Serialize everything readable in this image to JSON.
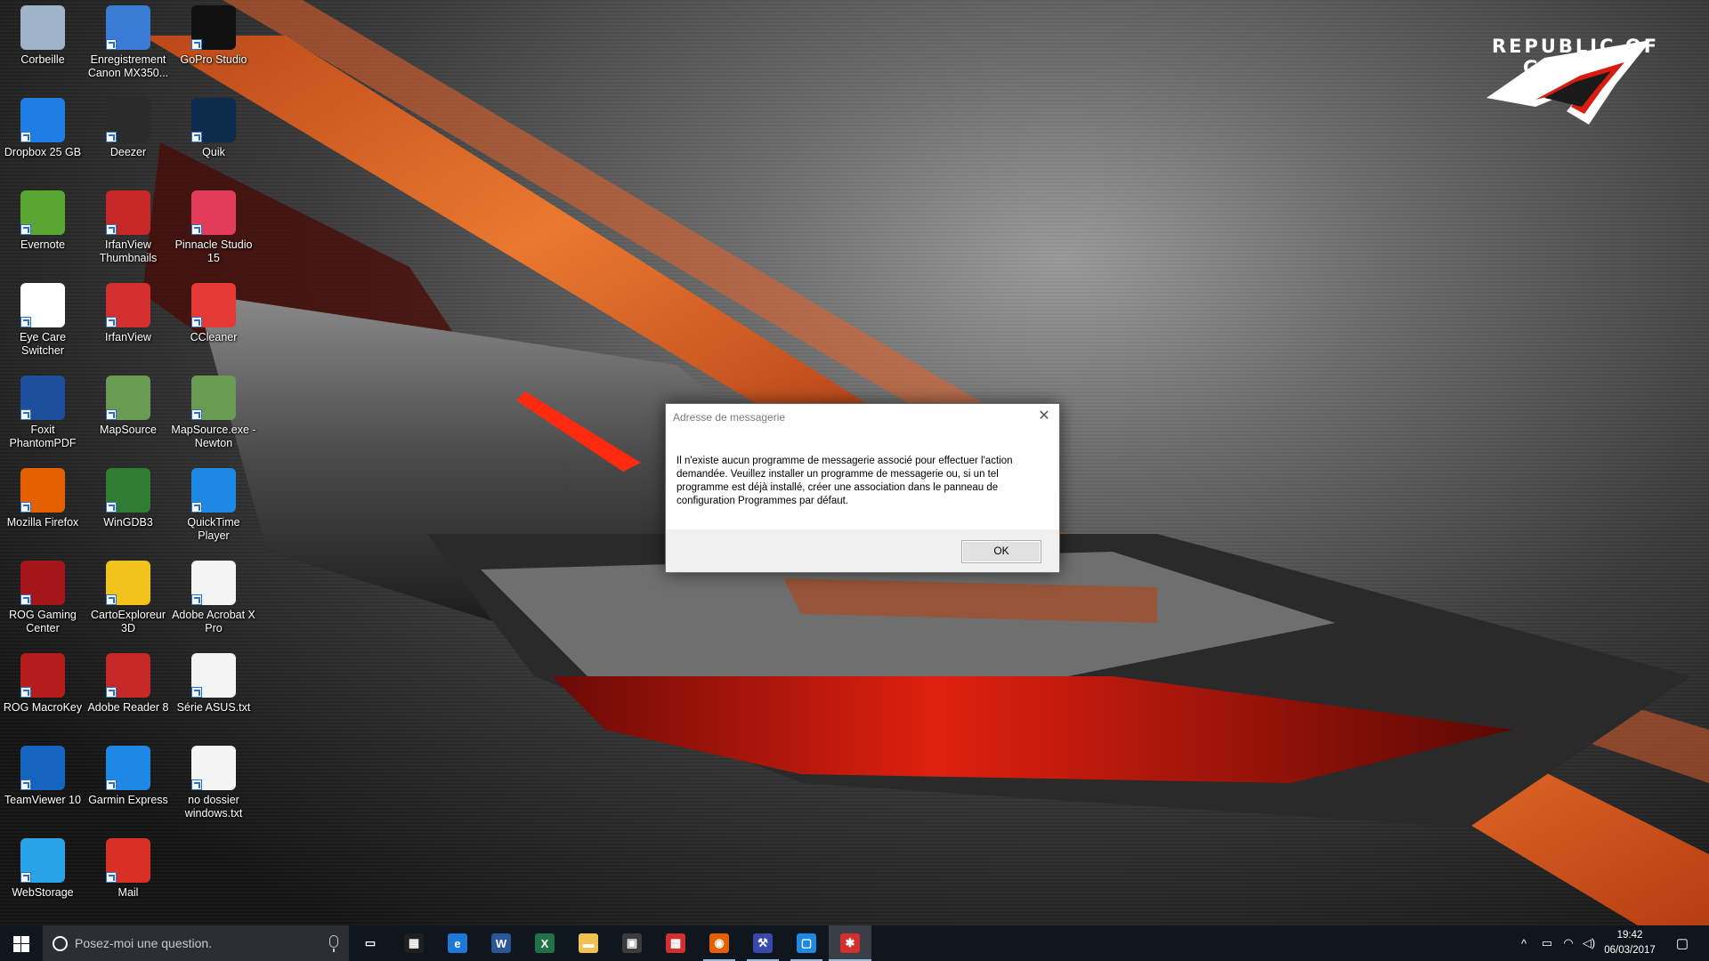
{
  "wallpaper": {
    "brand_line1": "REPUBLIC OF",
    "brand_line2": "GAMERS",
    "accent": "#e8622a",
    "red": "#d81c10"
  },
  "desktop": {
    "icons": [
      {
        "label": "Corbeille",
        "icon": "recycle-bin-icon",
        "color": "#9fb4c8"
      },
      {
        "label": "Enregistrement Canon MX350...",
        "icon": "canon-register-icon",
        "color": "#3a7bd5"
      },
      {
        "label": "GoPro Studio",
        "icon": "gopro-studio-icon",
        "color": "#111111"
      },
      {
        "label": "Dropbox 25 GB",
        "icon": "dropbox-icon",
        "color": "#1f7ee6"
      },
      {
        "label": "Deezer",
        "icon": "deezer-icon",
        "color": "#2b2b2b"
      },
      {
        "label": "Quik",
        "icon": "quik-icon",
        "color": "#0d2b4a"
      },
      {
        "label": "Evernote",
        "icon": "evernote-icon",
        "color": "#5aa632"
      },
      {
        "label": "IrfanView Thumbnails",
        "icon": "irfanview-thumbnails-icon",
        "color": "#c62828"
      },
      {
        "label": "Pinnacle Studio 15",
        "icon": "pinnacle-studio-icon",
        "color": "#e23c5a"
      },
      {
        "label": "Eye Care Switcher",
        "icon": "eye-care-icon",
        "color": "#ffffff"
      },
      {
        "label": "IrfanView",
        "icon": "irfanview-icon",
        "color": "#d32f2f"
      },
      {
        "label": "CCleaner",
        "icon": "ccleaner-icon",
        "color": "#e53935"
      },
      {
        "label": "Foxit PhantomPDF",
        "icon": "foxit-phantompdf-icon",
        "color": "#1e4f9c"
      },
      {
        "label": "MapSource",
        "icon": "mapsource-icon",
        "color": "#6a9b52"
      },
      {
        "label": "MapSource.exe - Newton",
        "icon": "mapsource-newton-icon",
        "color": "#6a9b52"
      },
      {
        "label": "Mozilla Firefox",
        "icon": "firefox-icon",
        "color": "#e66000"
      },
      {
        "label": "WinGDB3",
        "icon": "wingdb3-icon",
        "color": "#2e7d32"
      },
      {
        "label": "QuickTime Player",
        "icon": "quicktime-icon",
        "color": "#1e88e5"
      },
      {
        "label": "ROG Gaming Center",
        "icon": "rog-gaming-center-icon",
        "color": "#a4161a"
      },
      {
        "label": "CartoExploreur 3D",
        "icon": "cartoexploreur-icon",
        "color": "#f2c31b"
      },
      {
        "label": "Adobe Acrobat X Pro",
        "icon": "acrobat-pro-icon",
        "color": "#f4f4f4"
      },
      {
        "label": "ROG MacroKey",
        "icon": "rog-macrokey-icon",
        "color": "#b71c1c"
      },
      {
        "label": "Adobe Reader 8",
        "icon": "adobe-reader-icon",
        "color": "#c62828"
      },
      {
        "label": "Série ASUS.txt",
        "icon": "text-file-icon",
        "color": "#f4f4f4"
      },
      {
        "label": "TeamViewer 10",
        "icon": "teamviewer-icon",
        "color": "#1565c0"
      },
      {
        "label": "Garmin Express",
        "icon": "garmin-express-icon",
        "color": "#1e88e5"
      },
      {
        "label": "no dossier windows.txt",
        "icon": "text-file-icon",
        "color": "#f4f4f4"
      },
      {
        "label": "WebStorage",
        "icon": "webstorage-icon",
        "color": "#29a3e8"
      },
      {
        "label": "Mail",
        "icon": "gmail-icon",
        "color": "#d93025"
      }
    ]
  },
  "dialog": {
    "title": "Adresse de messagerie",
    "message": "Il n'existe aucun programme de messagerie associé pour effectuer l'action demandée. Veuillez installer un programme de messagerie ou, si un tel programme est déjà installé, créer une association dans le panneau de configuration Programmes par défaut.",
    "ok_label": "OK",
    "close_glyph": "✕"
  },
  "taskbar": {
    "search_placeholder": "Posez-moi une question.",
    "apps": [
      {
        "name": "task-view",
        "glyph": "▭",
        "color": "transparent"
      },
      {
        "name": "calculator",
        "glyph": "▦",
        "color": "#1f1f1f"
      },
      {
        "name": "edge",
        "glyph": "e",
        "color": "#1e78d7"
      },
      {
        "name": "word",
        "glyph": "W",
        "color": "#2b579a"
      },
      {
        "name": "excel",
        "glyph": "X",
        "color": "#217346"
      },
      {
        "name": "file-explorer",
        "glyph": "▬",
        "color": "#f2c14e"
      },
      {
        "name": "store",
        "glyph": "▣",
        "color": "#3c3c3c"
      },
      {
        "name": "gift",
        "glyph": "▩",
        "color": "#d32f2f"
      },
      {
        "name": "firefox",
        "glyph": "◉",
        "color": "#e66000"
      },
      {
        "name": "tool",
        "glyph": "⚒",
        "color": "#3949ab"
      },
      {
        "name": "window-app",
        "glyph": "▢",
        "color": "#1e88e5"
      },
      {
        "name": "irfanview",
        "glyph": "✱",
        "color": "#d32f2f"
      }
    ],
    "tray": {
      "chevron": "^",
      "battery": "▭",
      "wifi": "◠",
      "volume": "◁)",
      "notifications": "▢"
    },
    "time": "19:42",
    "date": "06/03/2017"
  }
}
